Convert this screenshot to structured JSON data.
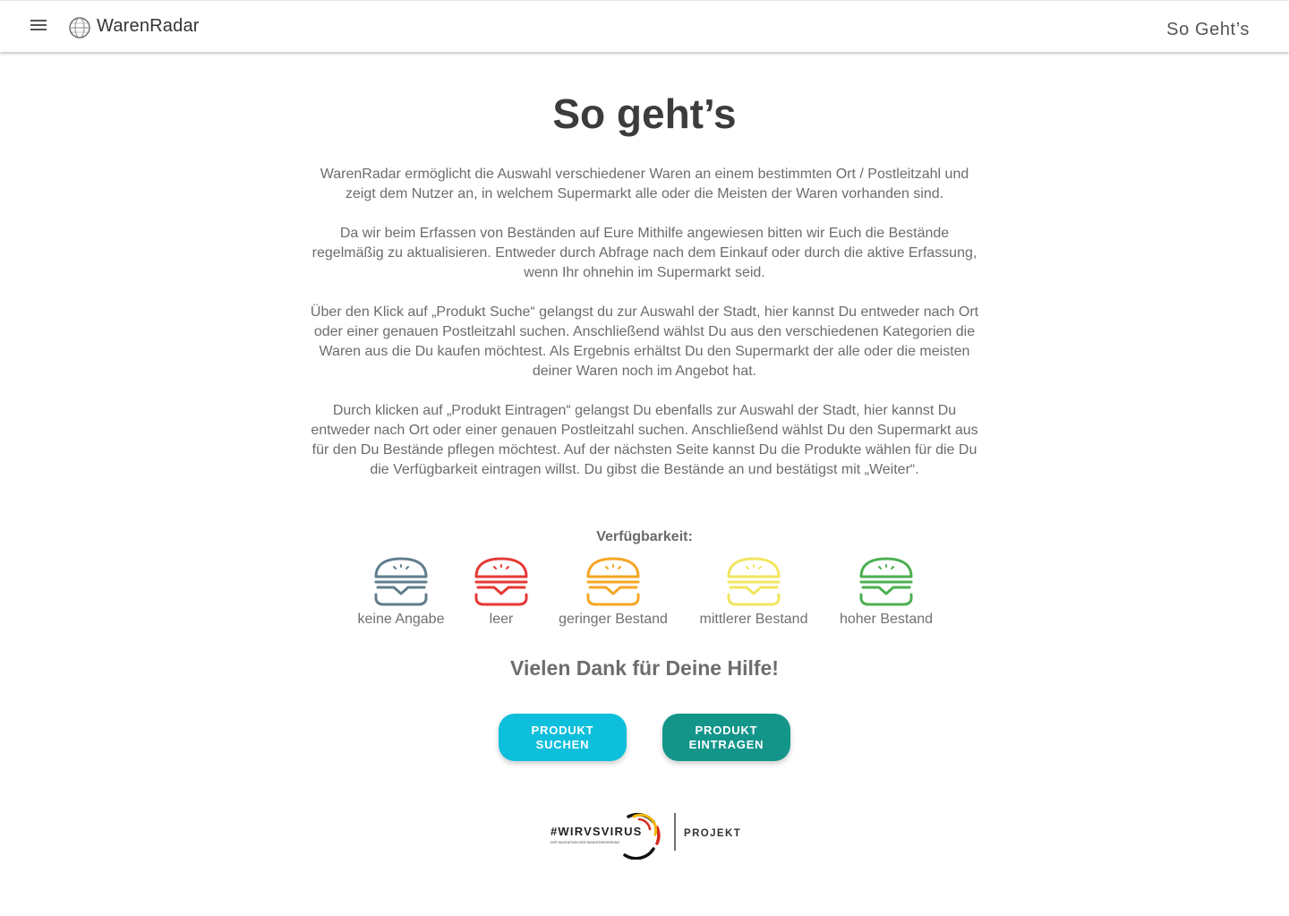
{
  "appbar": {
    "brand": "WarenRadar",
    "nav_link": "So Geht’s"
  },
  "page": {
    "title": "So geht’s",
    "paragraphs": [
      "WarenRadar ermöglicht die Auswahl verschiedener Waren an einem bestimmten Ort / Postleitzahl und zeigt dem Nutzer an, in welchem Supermarkt alle oder die Meisten der Waren vorhanden sind.",
      "Da wir beim Erfassen von Beständen auf Eure Mithilfe angewiesen bitten wir Euch die Bestände regelmäßig zu aktualisieren. Entweder durch Abfrage nach dem Einkauf oder durch die aktive Erfassung, wenn Ihr ohnehin im Supermarkt seid.",
      "Über den Klick auf „Produkt Suche“ gelangst du zur Auswahl der Stadt, hier kannst Du entweder nach Ort oder einer genauen Postleitzahl suchen. Anschließend wählst Du aus den verschiedenen Kategorien die Waren aus die Du kaufen möchtest. Als Ergebnis erhältst Du den Supermarkt der alle oder die meisten deiner Waren noch im Angebot hat.",
      "Durch klicken auf „Produkt Eintragen“ gelangst Du ebenfalls zur Auswahl der Stadt, hier kannst Du entweder nach Ort oder einer genauen Postleitzahl suchen. Anschließend wählst Du den Supermarkt aus für den Du Bestände pflegen möchtest. Auf der nächsten Seite kannst Du die Produkte wählen für die Du die Verfügbarkeit eintragen willst. Du gibst die Bestände an und bestätigst mit „Weiter“."
    ]
  },
  "availability": {
    "title": "Verfügbarkeit:",
    "levels": [
      {
        "label": "keine Angabe",
        "icon": "burger-icon",
        "color": "#607d8b"
      },
      {
        "label": "leer",
        "icon": "burger-icon",
        "color": "#e53935"
      },
      {
        "label": "geringer Bestand",
        "icon": "burger-icon",
        "color": "#f5a623"
      },
      {
        "label": "mittlerer Bestand",
        "icon": "burger-icon",
        "color": "#f2e55f"
      },
      {
        "label": "hoher Bestand",
        "icon": "burger-icon",
        "color": "#4caf50"
      }
    ]
  },
  "thanks": "Vielen Dank für Deine Hilfe!",
  "buttons": {
    "search": "PRODUKT SUCHEN",
    "enter": "PRODUKT EINTRAGEN"
  },
  "footer": {
    "logo_hashtag": "#WIRVSVIRUS",
    "logo_subtitle": "DER HACKATHON DER BUNDESREGIERUNG",
    "logo_label": "PROJEKT"
  },
  "colors": {
    "search_button": "#0ebfdc",
    "enter_button": "#14958a"
  }
}
